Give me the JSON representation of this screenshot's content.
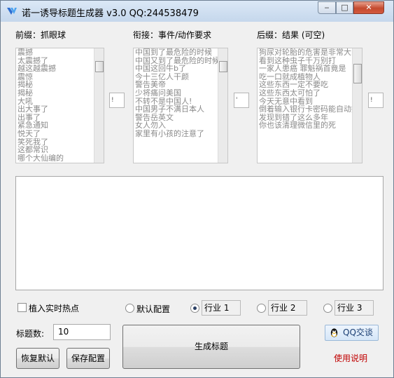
{
  "window": {
    "title": "诺一诱导标题生成器 v3.0 QQ:244538479",
    "controls": {
      "minimize": "‒",
      "maximize": "□",
      "close": "✕"
    }
  },
  "prefix": {
    "label": "前缀：抓眼球",
    "items": [
      "震撼",
      "太震撼了",
      "越这越震撼",
      "震惊",
      "揭秘",
      "揭秘",
      "大吼",
      "出大事了",
      "出事了",
      "紧急通知",
      "悦天了",
      "笑死我了",
      "这都常识",
      "哪个大仙编的"
    ],
    "count_value": "!"
  },
  "connector": {
    "label": "衔接：事件/动作要求",
    "items": [
      "中国到了最危险的时候",
      "中国又到了最危险的时候",
      "中国这回牛b了",
      "今十三亿人干颜",
      "警告美帝",
      "少将痛问美国",
      "不转不是中国人!",
      "中国男子不满日本人",
      "警告岳英文",
      "女人勿入",
      "家里有小孩的注意了"
    ],
    "count_value": "'"
  },
  "suffix": {
    "label": "后缀：结果 (可空)",
    "items": [
      "狗尿对轮胎的危害是非常大的",
      "看到这种虫子千万别打",
      "一家人患癌 罪魁祸首竟是",
      "吃一口就成植物人",
      "这些东西一定不要吃",
      "这些东西太可怕了",
      "今天无意中看到",
      "倒着输入银行卡密码能自动报警",
      "发现到错了这么多年",
      "你也该清理微信里的死"
    ],
    "count_value": "!"
  },
  "output": {
    "text": ""
  },
  "options": {
    "hot_topics_label": "植入实时热点",
    "hot_topics_checked": false,
    "default_config_label": "默认配置",
    "industry1_label": "行业 1",
    "industry2_label": "行业 2",
    "industry3_label": "行业 3",
    "selected": "industry1"
  },
  "title_count": {
    "label": "标题数:",
    "value": "10"
  },
  "buttons": {
    "restore_default": "恢复默认",
    "save_config": "保存配置",
    "generate": "生成标题",
    "qq_chat": "QQ交谈",
    "usage": "使用说明"
  }
}
